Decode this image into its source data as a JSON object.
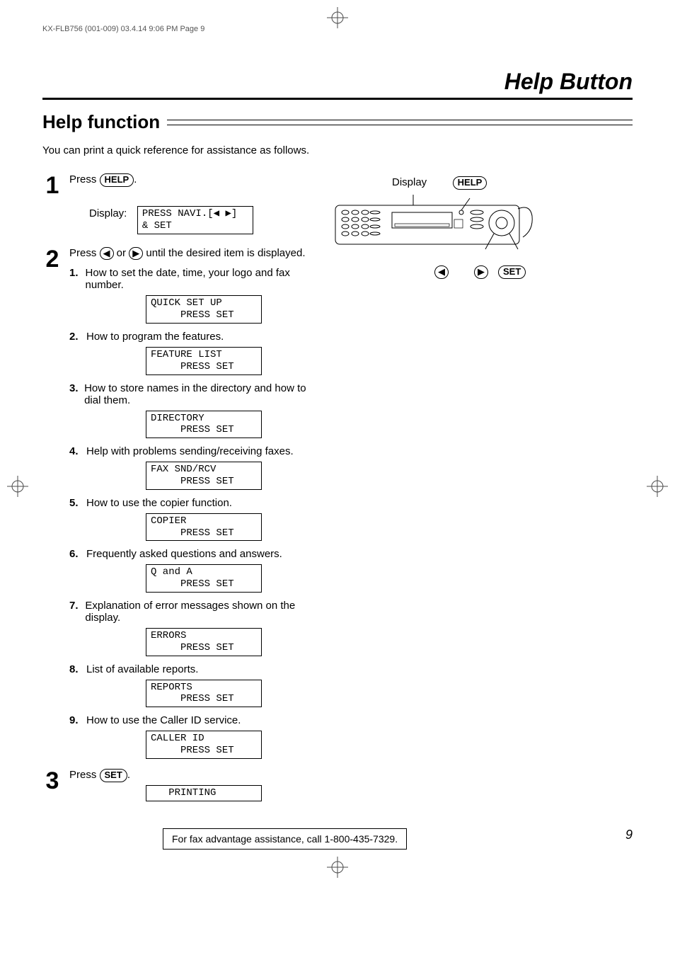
{
  "header_trim": "KX-FLB756 (001-009)  03.4.14  9:06 PM  Page 9",
  "page_title": "Help Button",
  "section_title": "Help function",
  "intro": "You can print a quick reference for assistance as follows.",
  "keys": {
    "help": "HELP",
    "set": "SET",
    "left": "◀",
    "right": "▶"
  },
  "display_label": "Display:",
  "display_caption": "Display",
  "steps": {
    "step1_num": "1",
    "step1_pre": "Press ",
    "step1_post": ".",
    "step1_lcd": "PRESS NAVI.[◀ ▶]\n& SET",
    "step2_num": "2",
    "step2_pre": "Press ",
    "step2_mid": " or ",
    "step2_post": " until the desired item is displayed.",
    "step3_num": "3",
    "step3_pre": "Press ",
    "step3_post": ".",
    "step3_lcd": "   PRINTING"
  },
  "items": [
    {
      "num": "1.",
      "text": "How to set the date, time, your logo and fax number.",
      "lcd": "QUICK SET UP\n     PRESS SET"
    },
    {
      "num": "2.",
      "text": "How to program the features.",
      "lcd": "FEATURE LIST\n     PRESS SET"
    },
    {
      "num": "3.",
      "text": "How to store names in the directory and how to dial them.",
      "lcd": "DIRECTORY\n     PRESS SET"
    },
    {
      "num": "4.",
      "text": "Help with problems sending/receiving faxes.",
      "lcd": "FAX SND/RCV\n     PRESS SET"
    },
    {
      "num": "5.",
      "text": "How to use the copier function.",
      "lcd": "COPIER\n     PRESS SET"
    },
    {
      "num": "6.",
      "text": "Frequently asked questions and answers.",
      "lcd": "Q and A\n     PRESS SET"
    },
    {
      "num": "7.",
      "text": "Explanation of error messages shown on the display.",
      "lcd": "ERRORS\n     PRESS SET"
    },
    {
      "num": "8.",
      "text": "List of available reports.",
      "lcd": "REPORTS\n     PRESS SET"
    },
    {
      "num": "9.",
      "text": "How to use the Caller ID service.",
      "lcd": "CALLER ID\n     PRESS SET"
    }
  ],
  "footer_box": "For fax advantage assistance, call 1-800-435-7329.",
  "page_num": "9"
}
